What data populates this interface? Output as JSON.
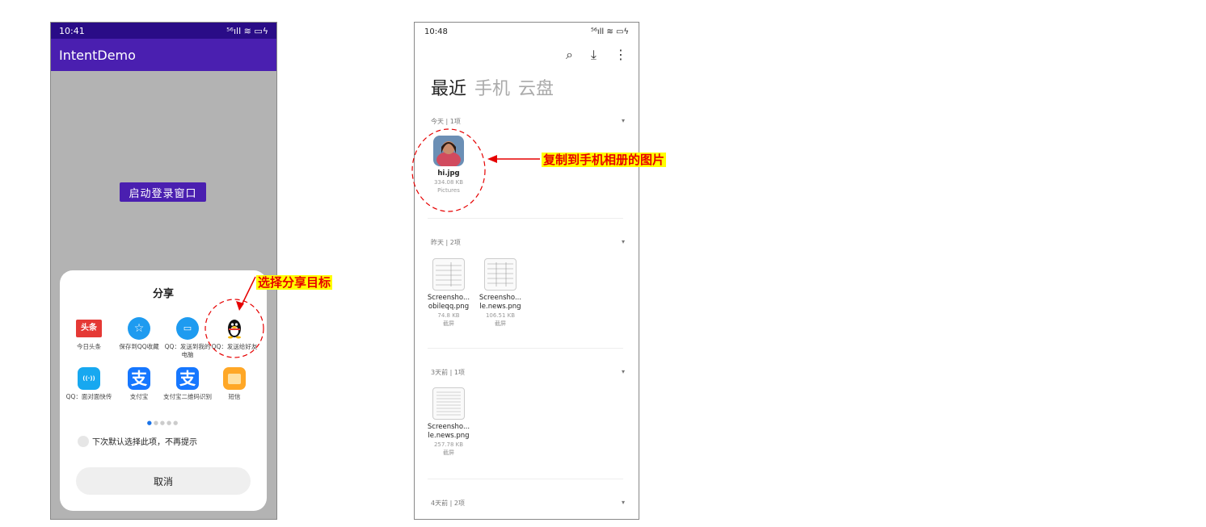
{
  "phone1": {
    "status_time": "10:41",
    "status_right": "⁵⁶ıll ≋ ▭ϟ",
    "app_title": "IntentDemo",
    "launch_button": "启动登录窗口",
    "share_sheet": {
      "title": "分享",
      "row1": [
        {
          "label": "今日头条",
          "icon_text": "头条",
          "color": "#e53935"
        },
        {
          "label": "保存到QQ收藏",
          "icon_text": "☆",
          "color": "#1e9bf0"
        },
        {
          "label": "QQ：发送到我的电脑",
          "icon_text": "▭",
          "color": "#1e9bf0"
        },
        {
          "label": "QQ：发送给好友",
          "icon_text": "",
          "color": "#ffffff"
        }
      ],
      "row2": [
        {
          "label": "QQ：面对面快传",
          "icon_text": "((·))",
          "color": "#17a8f0"
        },
        {
          "label": "支付宝",
          "icon_text": "支",
          "color": "#1677ff"
        },
        {
          "label": "支付宝二维码识别",
          "icon_text": "支",
          "color": "#1677ff"
        },
        {
          "label": "短信",
          "icon_text": "",
          "color": "#ffa726"
        }
      ],
      "remember_text": "下次默认选择此项，不再提示",
      "cancel": "取消"
    }
  },
  "phone2": {
    "status_time": "10:48",
    "status_right": "⁵⁶ıll ≋ ▭ϟ",
    "tabs": [
      "最近",
      "手机",
      "云盘"
    ],
    "sections": [
      {
        "header": "今天 | 1项",
        "files": [
          {
            "name": "hi.jpg",
            "size": "334.08 KB",
            "source": "Pictures"
          }
        ]
      },
      {
        "header": "昨天 | 2项",
        "files": [
          {
            "name": "Screensho... obileqq.png",
            "size": "74.8 KB",
            "source": "截屏"
          },
          {
            "name": "Screensho... le.news.png",
            "size": "106.51 KB",
            "source": "截屏"
          }
        ]
      },
      {
        "header": "3天前 | 1项",
        "files": [
          {
            "name": "Screensho... le.news.png",
            "size": "257.78 KB",
            "source": "截屏"
          }
        ]
      },
      {
        "header": "4天前 | 2项",
        "files": []
      }
    ]
  },
  "annotations": {
    "choose_target": "选择分享目标",
    "copied_photo": "复制到手机相册的图片"
  },
  "colors": {
    "accent": "#4a1fb0",
    "annotation": "#e60000"
  }
}
